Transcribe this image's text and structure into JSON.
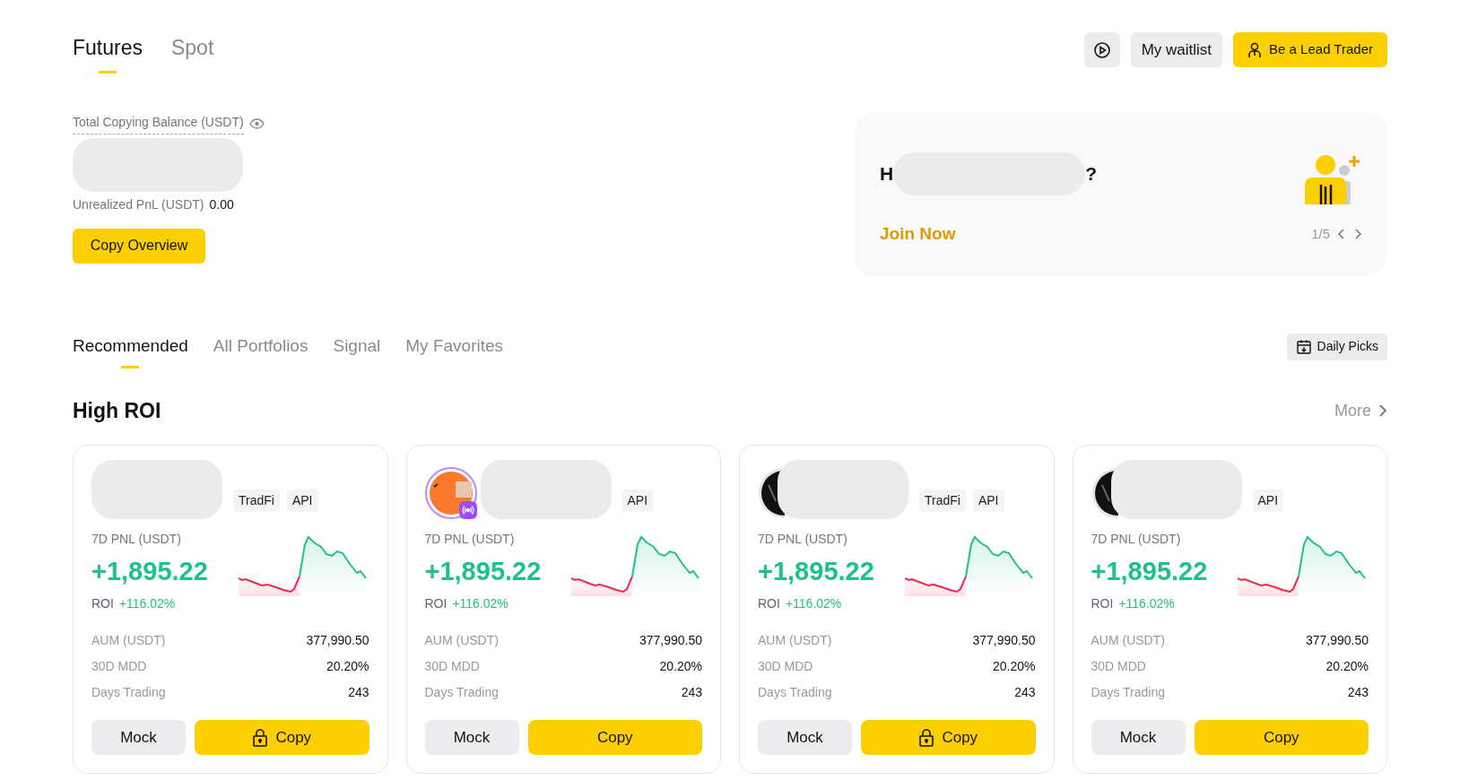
{
  "market_tabs": [
    {
      "label": "Futures",
      "selected": true
    },
    {
      "label": "Spot",
      "selected": false
    }
  ],
  "header_buttons": {
    "waitlist": "My waitlist",
    "lead_trader": "Be a Lead Trader"
  },
  "balance": {
    "label": "Total Copying Balance (USDT)",
    "unrealized_label": "Unrealized PnL (USDT)",
    "unrealized_value": "0.00",
    "button": "Copy Overview"
  },
  "banner": {
    "title_start": "H",
    "title_end": "?",
    "link": "Join Now",
    "pager": "1/5"
  },
  "list_tabs": [
    {
      "label": "Recommended",
      "selected": true
    },
    {
      "label": "All Portfolios",
      "selected": false
    },
    {
      "label": "Signal",
      "selected": false
    },
    {
      "label": "My Favorites",
      "selected": false
    }
  ],
  "daily_picks": "Daily Picks",
  "section": {
    "title": "High ROI",
    "more": "More"
  },
  "cards": [
    {
      "kind": "plain",
      "tags": [
        "TradFi",
        "API"
      ],
      "pnl_label": "7D PNL (USDT)",
      "pnl": "+1,895.22",
      "roi_label": "ROI",
      "roi": "+116.02%",
      "stats": [
        {
          "label": "AUM (USDT)",
          "value": "377,990.50"
        },
        {
          "label": "30D MDD",
          "value": "20.20%"
        },
        {
          "label": "Days Trading",
          "value": "243"
        }
      ],
      "mock": "Mock",
      "copy": "Copy",
      "locked": true
    },
    {
      "kind": "signal",
      "tags": [
        "API"
      ],
      "pnl_label": "7D PNL (USDT)",
      "pnl": "+1,895.22",
      "roi_label": "ROI",
      "roi": "+116.02%",
      "stats": [
        {
          "label": "AUM (USDT)",
          "value": "377,990.50"
        },
        {
          "label": "30D MDD",
          "value": "20.20%"
        },
        {
          "label": "Days Trading",
          "value": "243"
        }
      ],
      "mock": "Mock",
      "copy": "Copy",
      "locked": false
    },
    {
      "kind": "dark",
      "tags": [
        "TradFi",
        "API"
      ],
      "pnl_label": "7D PNL (USDT)",
      "pnl": "+1,895.22",
      "roi_label": "ROI",
      "roi": "+116.02%",
      "stats": [
        {
          "label": "AUM (USDT)",
          "value": "377,990.50"
        },
        {
          "label": "30D MDD",
          "value": "20.20%"
        },
        {
          "label": "Days Trading",
          "value": "243"
        }
      ],
      "mock": "Mock",
      "copy": "Copy",
      "locked": true
    },
    {
      "kind": "dark",
      "tags": [
        "API"
      ],
      "pnl_label": "7D PNL (USDT)",
      "pnl": "+1,895.22",
      "roi_label": "ROI",
      "roi": "+116.02%",
      "stats": [
        {
          "label": "AUM (USDT)",
          "value": "377,990.50"
        },
        {
          "label": "30D MDD",
          "value": "20.20%"
        },
        {
          "label": "Days Trading",
          "value": "243"
        }
      ],
      "mock": "Mock",
      "copy": "Copy",
      "locked": false
    }
  ]
}
